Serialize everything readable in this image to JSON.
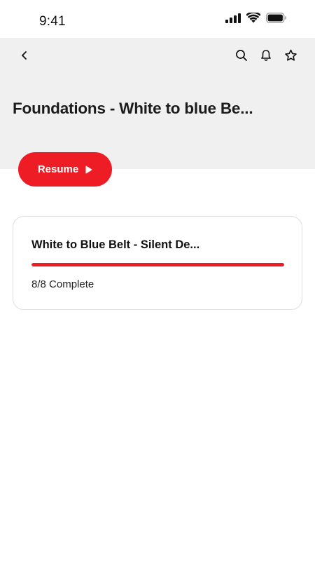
{
  "status_bar": {
    "time": "9:41",
    "icons": [
      "cellular-signal-icon",
      "wifi-icon",
      "battery-icon"
    ]
  },
  "nav": {
    "back_icon": "chevron-left-icon",
    "actions": [
      {
        "icon": "search-icon"
      },
      {
        "icon": "bell-icon"
      },
      {
        "icon": "star-icon"
      }
    ]
  },
  "header": {
    "title": "Foundations - White to blue Be..."
  },
  "resume_button": {
    "label": "Resume",
    "icon": "play-icon"
  },
  "course_card": {
    "title": "White to Blue Belt - Silent De...",
    "progress": 1.0,
    "status": "8/8 Complete"
  },
  "colors": {
    "accent": "#ee1c25",
    "header_bg": "#f0f0f0",
    "card_border": "#dedede"
  }
}
